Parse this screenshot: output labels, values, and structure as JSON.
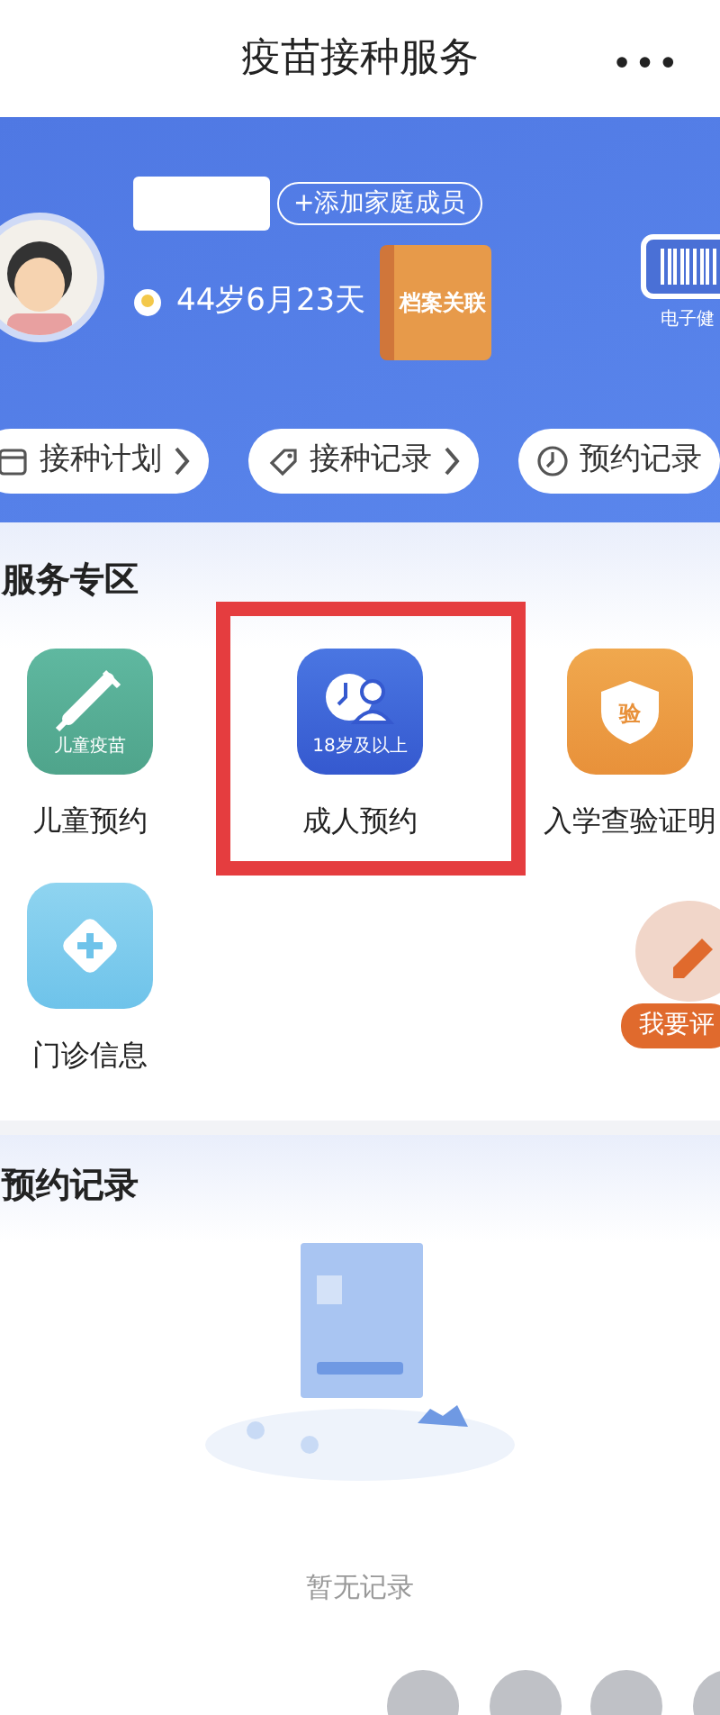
{
  "header": {
    "title": "疫苗接种服务",
    "menu": "•••"
  },
  "profile": {
    "add_member": "+添加家庭成员",
    "age": "44岁6月23天",
    "archive_badge": "档案关联",
    "health_card": "电子健"
  },
  "quick_tabs": [
    {
      "label": "接种计划"
    },
    {
      "label": "接种记录"
    },
    {
      "label": "预约记录"
    }
  ],
  "services": {
    "title": "服务专区",
    "items": [
      {
        "label": "儿童预约",
        "kind": "syringe",
        "caption": "儿童疫苗",
        "highlighted": false
      },
      {
        "label": "成人预约",
        "kind": "adult",
        "caption": "18岁及以上",
        "highlighted": true
      },
      {
        "label": "入学查验证明",
        "kind": "shield",
        "caption": "验",
        "highlighted": false
      },
      {
        "label": "门诊信息",
        "kind": "plus",
        "highlighted": false
      }
    ]
  },
  "review_button": "我要评",
  "appointments": {
    "title": "预约记录",
    "empty_text": "暂无记录"
  }
}
